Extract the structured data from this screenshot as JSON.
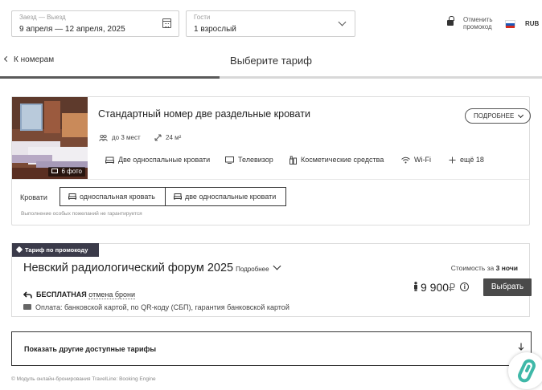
{
  "search": {
    "dates_label": "Заезд — Выезд",
    "dates_value": "9 апреля — 12 апреля, 2025",
    "guests_label": "Гости",
    "guests_value": "1 взрослый",
    "promo_cancel_label": "Отменить промокод",
    "currency": "RUB",
    "flag_colors": [
      "#ffffff",
      "#1c57b8",
      "#d52b1e"
    ]
  },
  "header": {
    "back_label": "К номерам",
    "title": "Выберите тариф",
    "progress_fraction": 0.405
  },
  "room": {
    "name": "Стандартный номер две раздельные кровати",
    "details_button": "ПОДРОБНЕЕ",
    "photo_count_label": "6 фото",
    "capacity": "до 3 мест",
    "area": "24 м²",
    "amenities": [
      {
        "icon": "bed-icon",
        "label": "Две односпальные кровати"
      },
      {
        "icon": "tv-icon",
        "label": "Телевизор"
      },
      {
        "icon": "cosmetics-icon",
        "label": "Косметические средства"
      },
      {
        "icon": "wifi-icon",
        "label": "Wi-Fi"
      },
      {
        "icon": "plus-icon",
        "label": "ещё 18"
      }
    ],
    "beds_label": "Кровати",
    "bed_options": [
      "односпальная кровать",
      "две односпальные кровати"
    ],
    "beds_note": "Выполнение особых пожеланий не гарантируется"
  },
  "tariff": {
    "tag": "Тариф по промокоду",
    "title": "Невский радиологический форум 2025",
    "details_link": "Подробнее",
    "cost_label_prefix": "Стоимость за ",
    "cost_label_nights": "3 ночи",
    "price": "9 900",
    "currency_sign": "₽",
    "select_button": "Выбрать",
    "cancel_bold": "БЕСПЛАТНАЯ",
    "cancel_text": "отмена брони",
    "payment": "Оплата: банковской картой, по QR-коду (СБП), гарантия банковской картой"
  },
  "other_tariffs_label": "Показать другие доступные тарифы",
  "footer": "© Модуль онлайн-бронирования TravelLine: Booking Engine",
  "colors": {
    "accent_dark": "#4a4a4a",
    "tag_bg": "#3b3b4a",
    "widget_green": "#3fb8a8"
  }
}
